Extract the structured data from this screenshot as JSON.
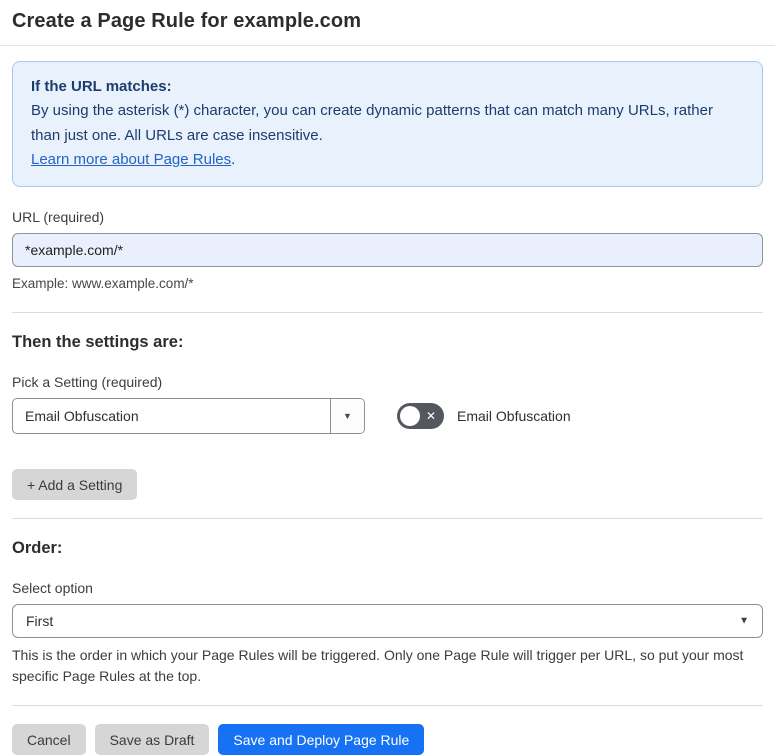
{
  "page": {
    "title": "Create a Page Rule for example.com"
  },
  "info_box": {
    "heading": "If the URL matches:",
    "body": "By using the asterisk (*) character, you can create dynamic patterns that can match many URLs, rather than just one. All URLs are case insensitive.",
    "link_text": "Learn more about Page Rules",
    "link_suffix": "."
  },
  "url_field": {
    "label": "URL (required)",
    "value": "*example.com/*",
    "helper": "Example: www.example.com/*"
  },
  "settings_section": {
    "heading": "Then the settings are:",
    "pick_label": "Pick a Setting (required)",
    "selected_setting": "Email Obfuscation",
    "toggle": {
      "state": "off",
      "label": "Email Obfuscation"
    },
    "add_button_label": "+ Add a Setting"
  },
  "order_section": {
    "heading": "Order:",
    "label": "Select option",
    "selected_option": "First",
    "helper": "This is the order in which your Page Rules will be triggered. Only one Page Rule will trigger per URL, so put your most specific Page Rules at the top."
  },
  "footer": {
    "cancel_label": "Cancel",
    "save_draft_label": "Save as Draft",
    "save_deploy_label": "Save and Deploy Page Rule"
  },
  "icons": {
    "dropdown_arrow": "▼",
    "toggle_off_glyph": "✕"
  },
  "colors": {
    "primary_blue": "#1672f2",
    "info_box_bg": "#e9f2fc",
    "info_box_border": "#a9c9ec",
    "info_box_text": "#1d3c6e",
    "link_blue": "#2563c4",
    "url_input_bg": "#e9effc",
    "toggle_off_bg": "#54585e",
    "gray_button_bg": "#d6d6d6"
  }
}
